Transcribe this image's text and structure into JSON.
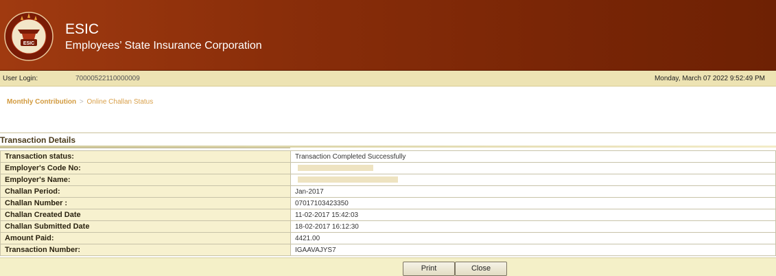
{
  "header": {
    "title": "ESIC",
    "subtitle": "Employees’ State Insurance Corporation",
    "logo": {
      "icon": "esic-emblem-logo",
      "emblem_text": "ESIC",
      "ring_text_left": "कर्मचारी राज्य बीमा निगम",
      "ring_text_right": "SOCIAL SECURITY",
      "colors": {
        "ring": "#7a1b06",
        "disc": "#f2e5c8",
        "accent": "#c0391b"
      }
    },
    "colors": {
      "background": "#7a2606"
    }
  },
  "user_bar": {
    "label": "User Login:",
    "user_id": "70000522110000009",
    "datetime": "Monday, March 07  2022 9:52:49 PM"
  },
  "breadcrumb": {
    "parent": "Monthly Contribution",
    "separator": ">",
    "current": "Online Challan Status"
  },
  "section": {
    "title": "Transaction Details"
  },
  "details": {
    "rows": [
      {
        "key": "Transaction status:",
        "value": "Transaction Completed Successfully",
        "status": "success"
      },
      {
        "key": "Employer's Code No:",
        "value": "",
        "masked": true
      },
      {
        "key": "Employer's Name:",
        "value": "",
        "masked": true
      },
      {
        "key": "Challan Period:",
        "value": "Jan-2017"
      },
      {
        "key": "Challan Number :",
        "value": "07017103423350"
      },
      {
        "key": "Challan Created Date",
        "value": "11-02-2017 15:42:03"
      },
      {
        "key": "Challan Submitted Date",
        "value": "18-02-2017 16:12:30"
      },
      {
        "key": "Amount Paid:",
        "value": "4421.00"
      },
      {
        "key": "Transaction Number:",
        "value": "IGAAVAJYS7"
      }
    ],
    "colors": {
      "success": "#1a7a2a",
      "key_background": "#f7f1cf"
    }
  },
  "footer": {
    "print_label": "Print",
    "close_label": "Close"
  }
}
